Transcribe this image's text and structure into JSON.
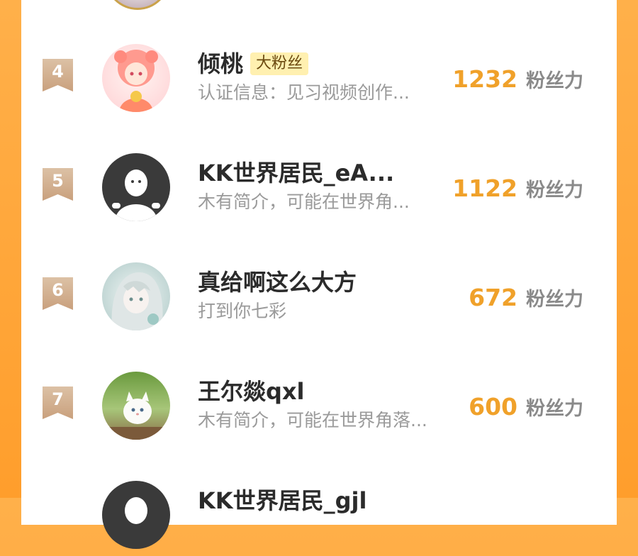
{
  "ranking": {
    "score_unit_label": "粉丝力",
    "rows": [
      {
        "rank": "4",
        "name": "倾桃",
        "tag": "大粉丝",
        "desc": "认证信息：见习视频创作...",
        "score": "1232"
      },
      {
        "rank": "5",
        "name": "KK世界居民_eA...",
        "tag": "",
        "desc": "木有简介，可能在世界角...",
        "score": "1122"
      },
      {
        "rank": "6",
        "name": "真给啊这么大方",
        "tag": "",
        "desc": "打到你七彩",
        "score": "672"
      },
      {
        "rank": "7",
        "name": "王尔燚qxl",
        "tag": "",
        "desc": "木有简介，可能在世界角落...",
        "score": "600"
      },
      {
        "rank": "",
        "name": "KK世界居民_gjl",
        "tag": "",
        "desc": "",
        "score": ""
      }
    ]
  },
  "colors": {
    "background": "#ff9e2c",
    "score": "#f0a12a",
    "rank_badge": "#d9b99a",
    "tag_bg": "#fff0b0"
  },
  "icons": {
    "rank_badge": "ribbon-badge-icon",
    "default_avatar": "default-user-avatar-icon"
  }
}
